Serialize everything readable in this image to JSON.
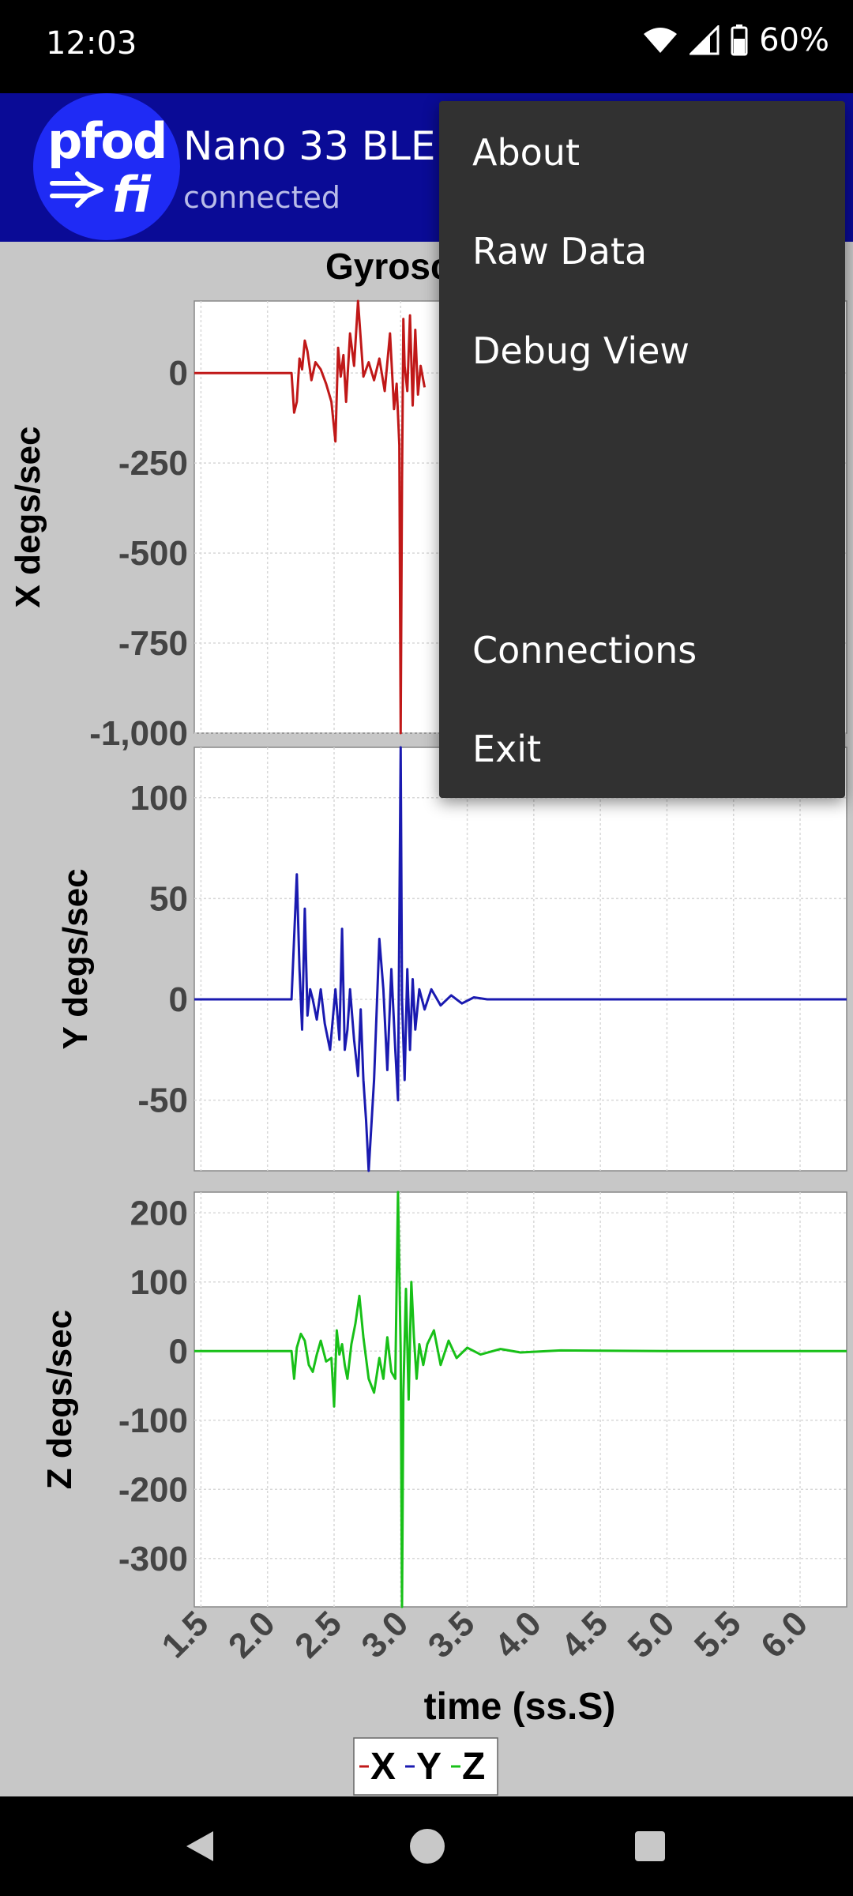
{
  "status": {
    "time": "12:03",
    "battery": "60%"
  },
  "app": {
    "logo_text": "pfod",
    "logo_sub": "fi",
    "title": "Nano 33 BLE",
    "subtitle": "connected"
  },
  "chart_title": "Gyrosc",
  "menu": {
    "items": [
      {
        "label": "About"
      },
      {
        "label": "Raw Data"
      },
      {
        "label": "Debug View"
      },
      {
        "label": "Connections"
      },
      {
        "label": "Exit"
      }
    ]
  },
  "chart_data": {
    "type": "line",
    "title": "Gyrosc",
    "xlabel": "time (ss.S)",
    "x_ticks": [
      "1.5",
      "2.0",
      "2.5",
      "3.0",
      "3.5",
      "4.0",
      "4.5",
      "5.0",
      "5.5",
      "6.0"
    ],
    "xlim": [
      1.45,
      6.35
    ],
    "legend": {
      "placement": "bottom-center",
      "items": [
        "X",
        "Y",
        "Z"
      ]
    },
    "colors": {
      "X": "#c01818",
      "Y": "#1a1ab0",
      "Z": "#18c018"
    },
    "grid": true,
    "panels": [
      {
        "ylabel": "X degs/sec",
        "ylim": [
          -1000,
          200
        ],
        "y_ticks": [
          0,
          -250,
          -500,
          -750,
          -1000
        ],
        "y_tick_labels": [
          "0",
          "-250",
          "-500",
          "-750",
          "-1,000"
        ],
        "series": {
          "name": "X",
          "color": "#c01818",
          "x": [
            1.45,
            2.18,
            2.2,
            2.22,
            2.24,
            2.26,
            2.28,
            2.3,
            2.33,
            2.36,
            2.4,
            2.44,
            2.48,
            2.51,
            2.53,
            2.55,
            2.57,
            2.59,
            2.62,
            2.65,
            2.68,
            2.72,
            2.76,
            2.8,
            2.84,
            2.88,
            2.92,
            2.95,
            2.97,
            2.99,
            3.0,
            3.01,
            3.02,
            3.03,
            3.05,
            3.07,
            3.09,
            3.11,
            3.13,
            3.15,
            3.18
          ],
          "y": [
            0,
            0,
            -110,
            -80,
            40,
            10,
            90,
            60,
            -20,
            30,
            10,
            -30,
            -80,
            -190,
            70,
            -10,
            50,
            -80,
            110,
            20,
            200,
            -10,
            30,
            -20,
            40,
            -50,
            110,
            -100,
            -30,
            -200,
            -1000,
            -300,
            150,
            20,
            -50,
            160,
            -90,
            120,
            -60,
            20,
            -40
          ]
        }
      },
      {
        "ylabel": "Y degs/sec",
        "ylim": [
          -85,
          125
        ],
        "y_ticks": [
          100,
          50,
          0,
          -50
        ],
        "y_tick_labels": [
          "100",
          "50",
          "0",
          "-50"
        ],
        "series": {
          "name": "Y",
          "color": "#1a1ab0",
          "x": [
            1.45,
            2.18,
            2.22,
            2.24,
            2.26,
            2.28,
            2.3,
            2.32,
            2.34,
            2.37,
            2.4,
            2.43,
            2.47,
            2.51,
            2.54,
            2.56,
            2.58,
            2.6,
            2.62,
            2.65,
            2.68,
            2.7,
            2.72,
            2.74,
            2.76,
            2.8,
            2.84,
            2.87,
            2.9,
            2.93,
            2.96,
            2.98,
            3.0,
            3.01,
            3.03,
            3.05,
            3.07,
            3.09,
            3.11,
            3.14,
            3.18,
            3.23,
            3.3,
            3.38,
            3.46,
            3.55,
            3.65,
            3.8,
            4.0,
            4.3,
            5.0,
            6.35
          ],
          "y": [
            0,
            0,
            62,
            15,
            -15,
            45,
            -8,
            5,
            0,
            -10,
            5,
            -12,
            -25,
            5,
            -20,
            35,
            -25,
            -15,
            5,
            -20,
            -38,
            -5,
            -40,
            -60,
            -85,
            -40,
            30,
            5,
            -35,
            15,
            -25,
            -50,
            125,
            0,
            -40,
            15,
            -25,
            10,
            -15,
            5,
            -5,
            5,
            -3,
            2,
            -2,
            1,
            0,
            0,
            0,
            0,
            0,
            0
          ]
        }
      },
      {
        "ylabel": "Z degs/sec",
        "ylim": [
          -370,
          230
        ],
        "y_ticks": [
          200,
          100,
          0,
          -100,
          -200,
          -300
        ],
        "y_tick_labels": [
          "200",
          "100",
          "0",
          "-100",
          "-200",
          "-300"
        ],
        "series": {
          "name": "Z",
          "color": "#18c018",
          "x": [
            1.45,
            2.18,
            2.2,
            2.22,
            2.25,
            2.28,
            2.31,
            2.34,
            2.37,
            2.4,
            2.44,
            2.48,
            2.5,
            2.52,
            2.54,
            2.56,
            2.58,
            2.6,
            2.63,
            2.66,
            2.69,
            2.72,
            2.76,
            2.8,
            2.84,
            2.87,
            2.9,
            2.93,
            2.96,
            2.98,
            3.0,
            3.01,
            3.02,
            3.04,
            3.06,
            3.08,
            3.1,
            3.12,
            3.14,
            3.17,
            3.2,
            3.25,
            3.3,
            3.36,
            3.42,
            3.5,
            3.6,
            3.75,
            3.9,
            4.2,
            5.0,
            6.35
          ],
          "y": [
            0,
            0,
            -40,
            5,
            25,
            15,
            -20,
            -30,
            -5,
            15,
            -15,
            -10,
            -80,
            30,
            -5,
            10,
            -20,
            -40,
            10,
            40,
            80,
            20,
            -40,
            -60,
            -10,
            -40,
            20,
            -30,
            -40,
            230,
            0,
            -370,
            -60,
            90,
            -70,
            100,
            20,
            -40,
            10,
            -20,
            10,
            30,
            -20,
            15,
            -10,
            5,
            -5,
            3,
            -2,
            1,
            0,
            0
          ]
        }
      }
    ]
  }
}
